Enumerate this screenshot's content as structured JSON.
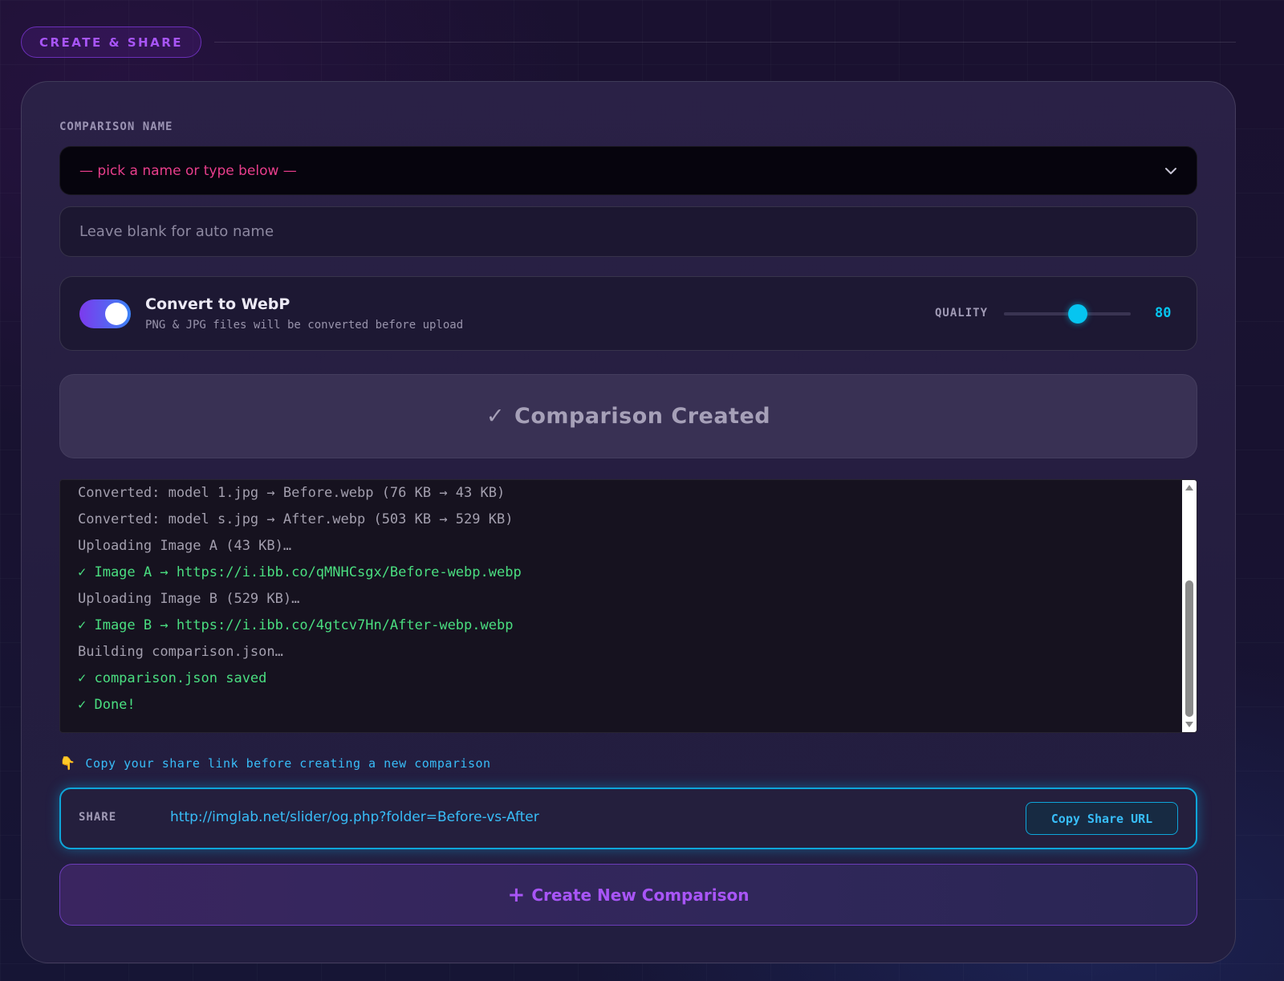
{
  "section": {
    "title": "CREATE & SHARE"
  },
  "name_field": {
    "label": "COMPARISON NAME",
    "select_value": "— pick a name or type below —",
    "input_placeholder": "Leave blank for auto name"
  },
  "webp": {
    "enabled": true,
    "title": "Convert to WebP",
    "subtitle": "PNG & JPG files will be converted before upload",
    "quality_label": "QUALITY",
    "quality_value": "80",
    "quality_fraction": 0.58
  },
  "status_button": {
    "check": "✓",
    "label": "Comparison Created"
  },
  "log": {
    "lines": [
      {
        "kind": "info",
        "text": "Converted: model 1.jpg → Before.webp (76 KB → 43 KB)"
      },
      {
        "kind": "info",
        "text": "Converted: model s.jpg → After.webp (503 KB → 529 KB)"
      },
      {
        "kind": "info",
        "text": "Uploading Image A (43 KB)…"
      },
      {
        "kind": "ok",
        "text": "✓ Image A → https://i.ibb.co/qMNHCsgx/Before-webp.webp"
      },
      {
        "kind": "info",
        "text": "Uploading Image B (529 KB)…"
      },
      {
        "kind": "ok",
        "text": "✓ Image B → https://i.ibb.co/4gtcv7Hn/After-webp.webp"
      },
      {
        "kind": "info",
        "text": "Building comparison.json…"
      },
      {
        "kind": "ok",
        "text": "✓ comparison.json saved"
      },
      {
        "kind": "ok",
        "text": "✓ Done!"
      }
    ]
  },
  "hint": {
    "icon": "pointing-hand-icon",
    "text": "Copy your share link before creating a new comparison"
  },
  "share": {
    "label": "SHARE",
    "url": "http://imglab.net/slider/og.php?folder=Before-vs-After",
    "copy_label": "Copy Share URL"
  },
  "new_button": {
    "icon": "+",
    "label": "Create New Comparison"
  },
  "colors": {
    "accent_purple": "#a855f7",
    "accent_cyan": "#06c5f0",
    "success_green": "#4ade80",
    "placeholder_pink": "#e83e8c"
  }
}
